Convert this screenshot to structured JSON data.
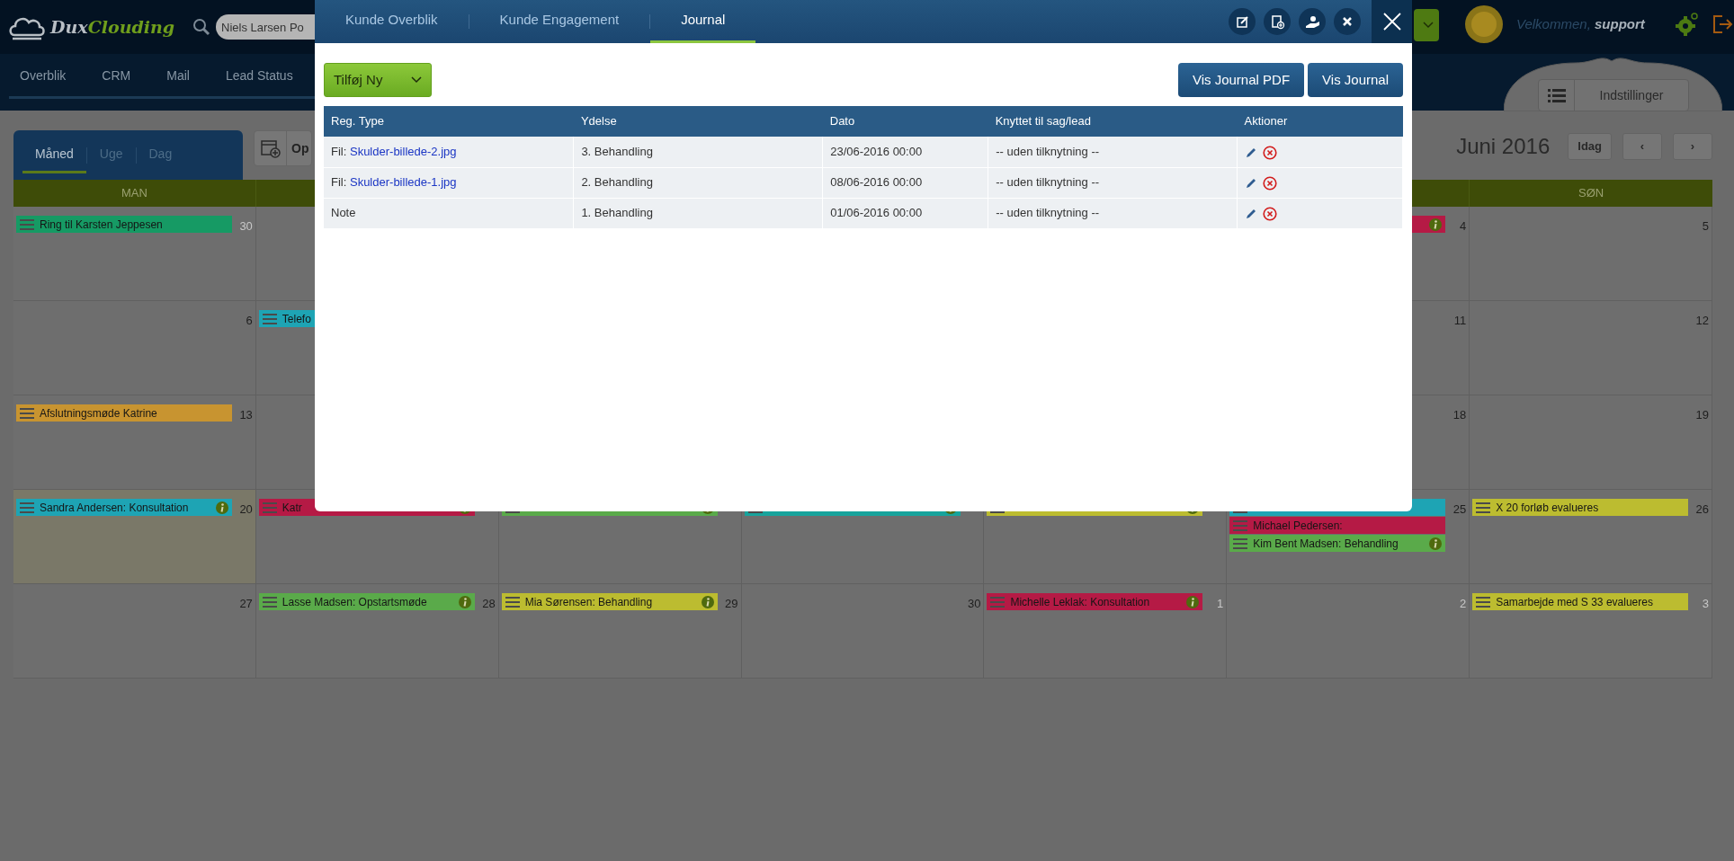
{
  "app": {
    "logo": {
      "part1": "Dux",
      "part2": "Clouding"
    },
    "search": {
      "value": "Niels Larsen Po"
    },
    "welcome": "Velkommen, **support**",
    "settings_button": "Indstillinger"
  },
  "nav": [
    {
      "label": "Overblik"
    },
    {
      "label": "CRM"
    },
    {
      "label": "Mail"
    },
    {
      "label": "Lead Status"
    }
  ],
  "calendar": {
    "views": [
      {
        "label": "Måned",
        "selected": true
      },
      {
        "label": "Uge",
        "selected": false
      },
      {
        "label": "Dag",
        "selected": false
      }
    ],
    "toolbar_button": "Op",
    "month": "Juni 2016",
    "today_button": "Idag",
    "prev": "‹",
    "next": "›",
    "day_headers": {
      "first": "MAN",
      "last": "SØN"
    },
    "weeks": [
      {
        "days": {
          "mon": {
            "number": "30",
            "other_month": true,
            "events": [
              {
                "title": "Ring til Karsten Jeppesen",
                "color": "#169a64"
              }
            ]
          },
          "sat": {
            "number": "4",
            "events": [
              {
                "color": "#b51a45",
                "info": true
              }
            ]
          },
          "sun": {
            "number": "5"
          }
        }
      },
      {
        "days": {
          "mon": {
            "number": "6"
          },
          "tue": {
            "events": [
              {
                "title": "Telefo",
                "color": "#1ea4b4"
              }
            ]
          },
          "sat": {
            "number": "11"
          },
          "sun": {
            "number": "12"
          }
        }
      },
      {
        "days": {
          "mon": {
            "number": "13",
            "events": [
              {
                "title": "Afslutningsmøde Katrine",
                "color": "#c89430"
              }
            ]
          },
          "sat": {
            "number": "18"
          },
          "sun": {
            "number": "19"
          }
        }
      },
      {
        "days": {
          "mon": {
            "number": "20",
            "today": true,
            "events": [
              {
                "title": "Sandra Andersen: Konsultation",
                "color": "#1ea4b4",
                "info": true
              }
            ]
          },
          "tue": {
            "events": [
              {
                "title": "Katr",
                "color": "#b51a45",
                "info": true
              }
            ]
          },
          "wed": {
            "events": [
              {
                "color": "#5aaa4a",
                "info": true
              }
            ]
          },
          "thu": {
            "events": [
              {
                "color": "#17a39c",
                "info": true
              }
            ]
          },
          "fri": {
            "events": [
              {
                "color": "#bcbc30",
                "info": true
              }
            ]
          },
          "sat": {
            "number": "25",
            "events": [
              {
                "color": "#1ea4b4"
              },
              {
                "title": "Michael Pedersen:",
                "color": "#b51a45"
              },
              {
                "title": "Kim Bent Madsen: Behandling",
                "color": "#5aaa4a",
                "info": true
              }
            ]
          },
          "sun": {
            "number": "26",
            "events": [
              {
                "title": "X 20 forløb evalueres",
                "color": "#bcbc30"
              }
            ]
          }
        }
      },
      {
        "days": {
          "mon": {
            "number": "27"
          },
          "tue": {
            "number": "28",
            "events": [
              {
                "title": "Lasse Madsen: Opstartsmøde",
                "color": "#5aaa4a",
                "info": true
              }
            ]
          },
          "wed": {
            "number": "29",
            "events": [
              {
                "title": "Mia Sørensen: Behandling",
                "color": "#bcbc30",
                "info": true
              }
            ]
          },
          "thu": {
            "number": "30"
          },
          "fri": {
            "number": "1",
            "other_month": true,
            "events": [
              {
                "title": "Michelle Leklak: Konsultation",
                "color": "#b51a45",
                "info": true
              }
            ]
          },
          "sat": {
            "number": "2",
            "other_month": true
          },
          "sun": {
            "number": "3",
            "other_month": true,
            "events": [
              {
                "title": "Samarbejde med S 33 evalueres",
                "color": "#bcbc30"
              }
            ]
          }
        }
      }
    ]
  },
  "dialog": {
    "tabs": [
      {
        "label": "Kunde Overblik",
        "selected": false
      },
      {
        "label": "Kunde Engagement",
        "selected": false
      },
      {
        "label": "Journal",
        "selected": true
      }
    ],
    "add_button": "Tilføj Ny",
    "buttons": [
      "Vis Journal PDF",
      "Vis Journal"
    ],
    "table": {
      "columns": [
        "Reg. Type",
        "Ydelse",
        "Dato",
        "Knyttet til sag/lead",
        "Aktioner"
      ],
      "rows": [
        {
          "reg_type": {
            "label": "Fil:",
            "link": "Skulder-billede-2.jpg"
          },
          "ydelse": "3. Behandling",
          "dato": "23/06-2016 00:00",
          "knyttet": "-- uden tilknytning --"
        },
        {
          "reg_type": {
            "label": "Fil:",
            "link": "Skulder-billede-1.jpg"
          },
          "ydelse": "2. Behandling",
          "dato": "08/06-2016 00:00",
          "knyttet": "-- uden tilknytning --"
        },
        {
          "reg_type": {
            "label": "Note"
          },
          "ydelse": "1. Behandling",
          "dato": "01/06-2016 00:00",
          "knyttet": "-- uden tilknytning --"
        }
      ]
    }
  }
}
